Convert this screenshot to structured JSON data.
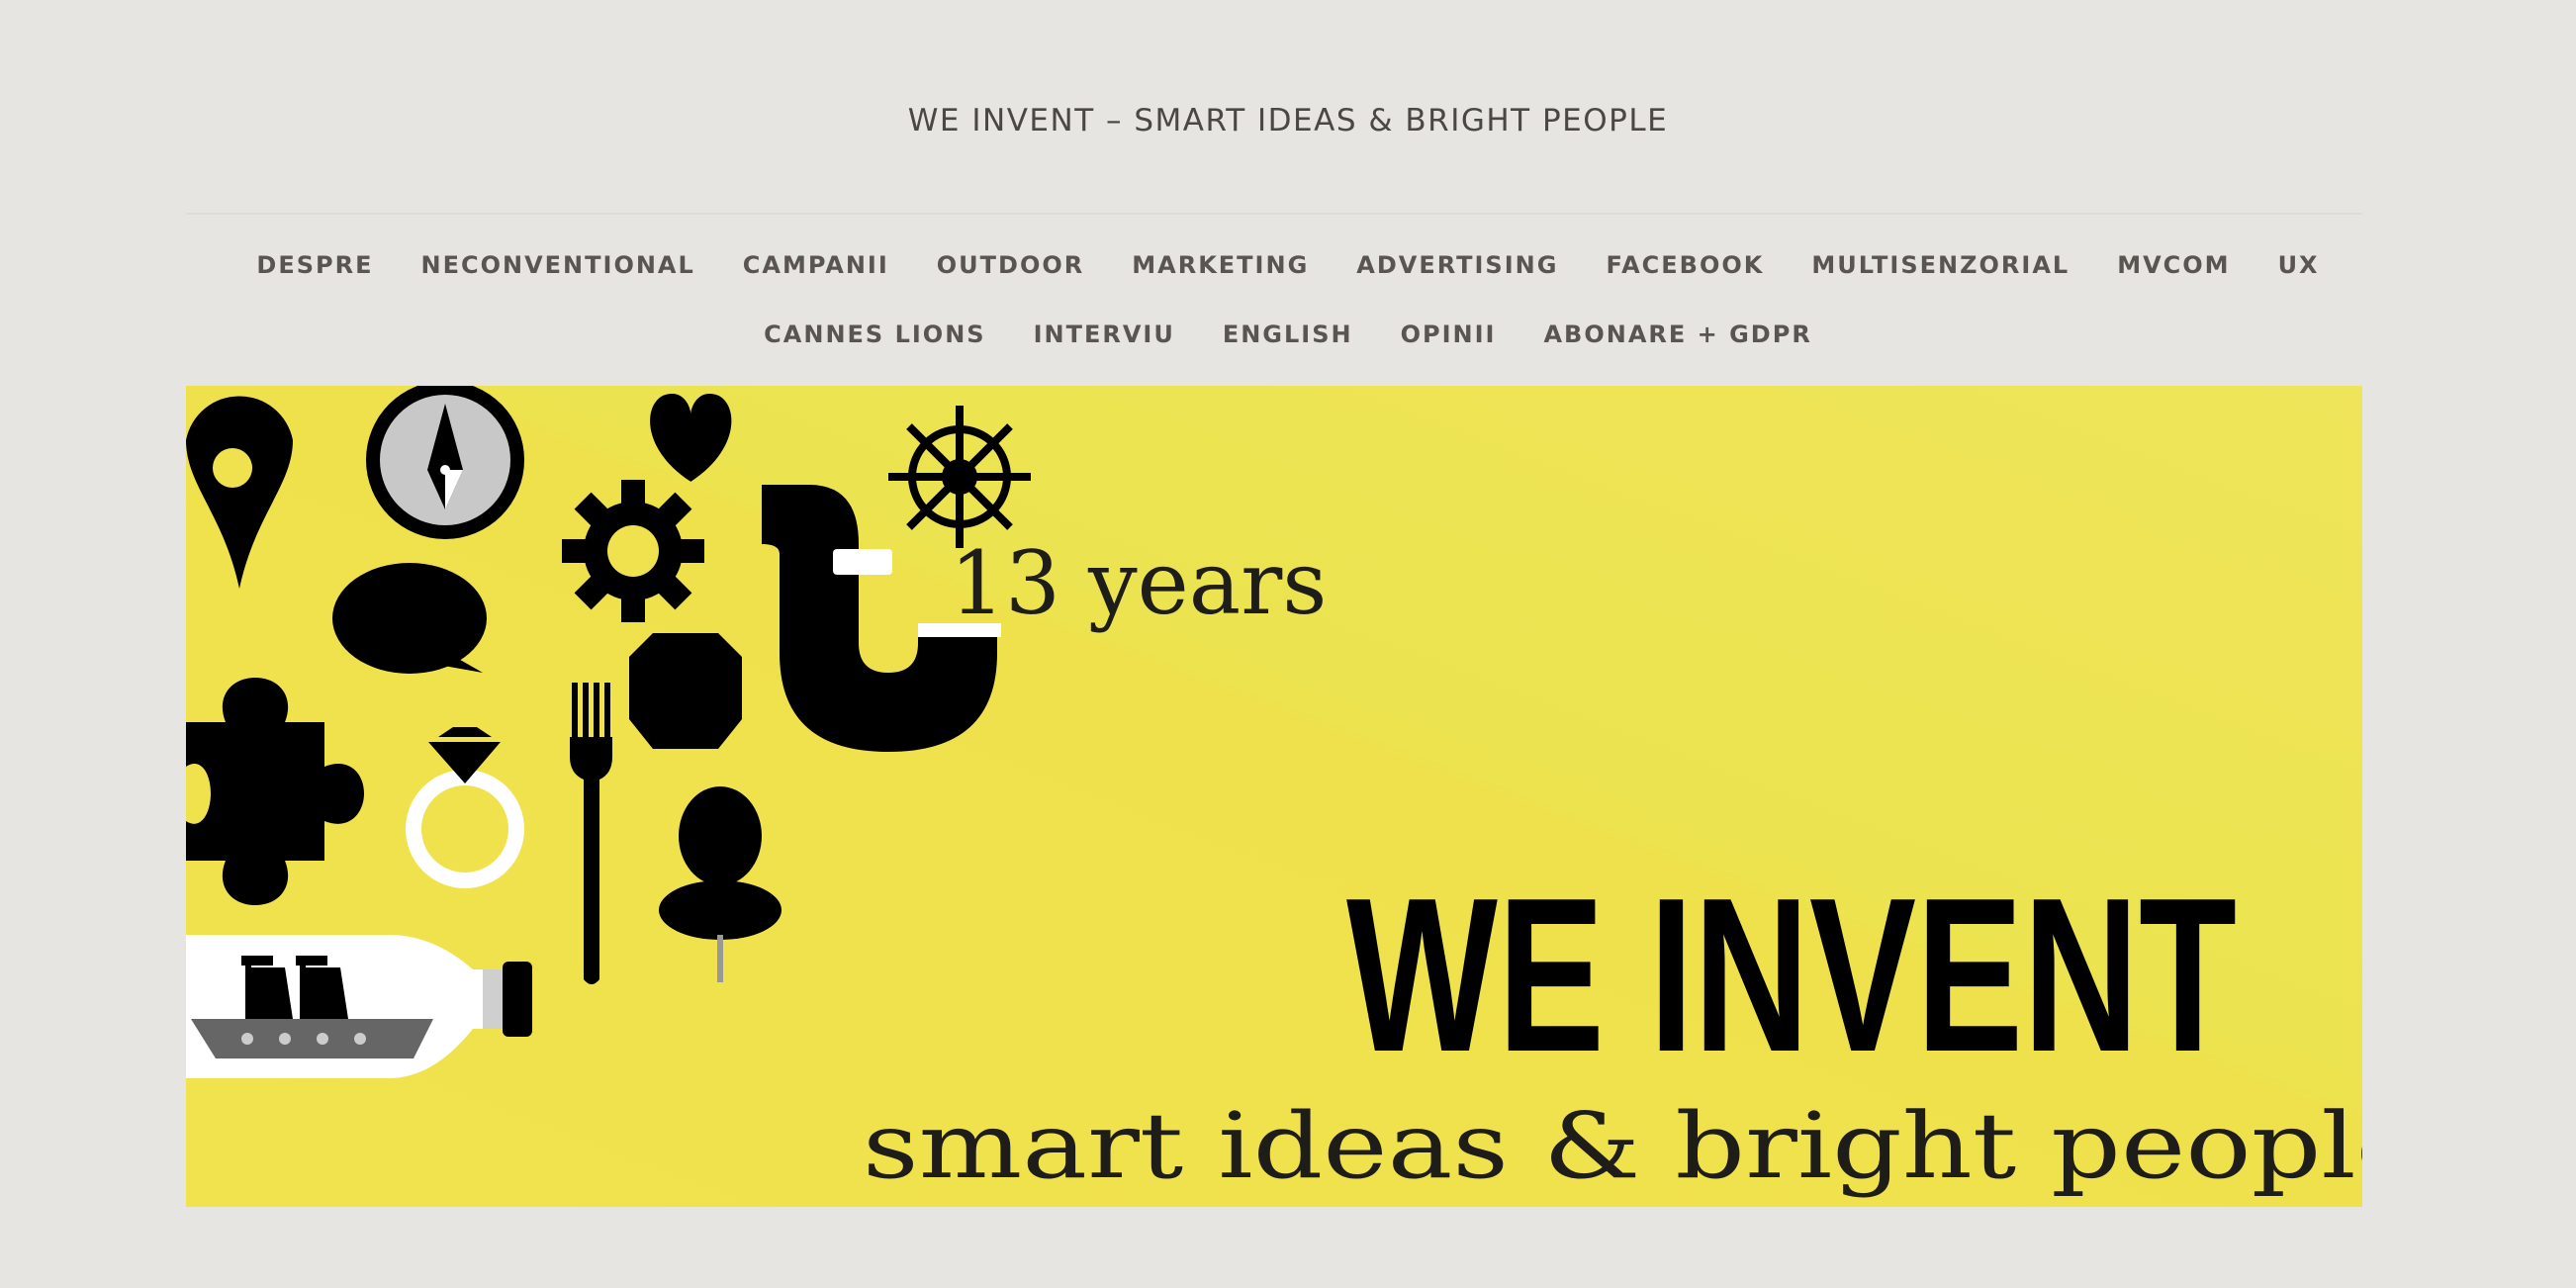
{
  "site": {
    "title": "WE INVENT – SMART IDEAS & BRIGHT PEOPLE"
  },
  "nav": {
    "row1": [
      {
        "label": "DESPRE",
        "name": "nav-item-despre"
      },
      {
        "label": "NECONVENTIONAL",
        "name": "nav-item-neconventional"
      },
      {
        "label": "CAMPANII",
        "name": "nav-item-campanii"
      },
      {
        "label": "OUTDOOR",
        "name": "nav-item-outdoor"
      },
      {
        "label": "MARKETING",
        "name": "nav-item-marketing"
      },
      {
        "label": "ADVERTISING",
        "name": "nav-item-advertising"
      },
      {
        "label": "FACEBOOK",
        "name": "nav-item-facebook"
      },
      {
        "label": "MULTISENZORIAL",
        "name": "nav-item-multisenzorial"
      },
      {
        "label": "MVCOM",
        "name": "nav-item-mvcom"
      },
      {
        "label": "UX",
        "name": "nav-item-ux"
      }
    ],
    "row2": [
      {
        "label": "CANNES LIONS",
        "name": "nav-item-cannes-lions"
      },
      {
        "label": "INTERVIU",
        "name": "nav-item-interviu"
      },
      {
        "label": "ENGLISH",
        "name": "nav-item-english"
      },
      {
        "label": "OPINII",
        "name": "nav-item-opinii"
      },
      {
        "label": "ABONARE + GDPR",
        "name": "nav-item-abonare-gdpr"
      }
    ]
  },
  "hero": {
    "years_text": "13 years",
    "headline": "WE INVENT",
    "tagline": "smart ideas & bright people",
    "background_color": "#f0e24e",
    "icons": [
      "map-pin-icon",
      "compass-icon",
      "heart-icon",
      "ship-wheel-icon",
      "gear-icon",
      "pipe-icon",
      "speech-bubble-icon",
      "hexagon-icon",
      "puzzle-piece-icon",
      "ring-icon",
      "fork-icon",
      "push-pin-icon",
      "ship-in-bottle-icon"
    ]
  },
  "colors": {
    "page_background": "#e6e5e1",
    "title_text": "#4a4744",
    "nav_text": "#5a5551",
    "hero_yellow": "#f0e24e"
  }
}
